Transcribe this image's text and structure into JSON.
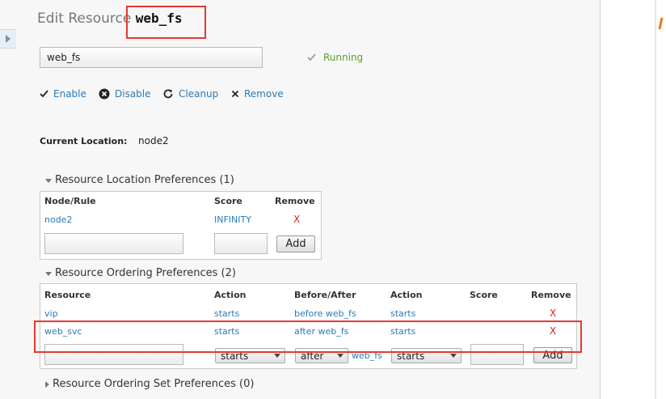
{
  "page": {
    "title_prefix": "Edit Resource",
    "resource_name": "web_fs"
  },
  "name_field": {
    "value": "web_fs"
  },
  "status": {
    "text": "Running",
    "color": "#5aa02c"
  },
  "actions": [
    {
      "label": "Enable",
      "icon": "check-icon"
    },
    {
      "label": "Disable",
      "icon": "disable-icon"
    },
    {
      "label": "Cleanup",
      "icon": "refresh-icon"
    },
    {
      "label": "Remove",
      "icon": "close-icon"
    }
  ],
  "current_location": {
    "label": "Current Location:",
    "value": "node2"
  },
  "location_prefs": {
    "title": "Resource Location Preferences (1)",
    "headers": {
      "node": "Node/Rule",
      "score": "Score",
      "remove": "Remove"
    },
    "rows": [
      {
        "node": "node2",
        "score": "INFINITY",
        "remove": "X"
      }
    ],
    "add_label": "Add"
  },
  "ordering_prefs": {
    "title": "Resource Ordering Preferences (2)",
    "headers": {
      "resource": "Resource",
      "action": "Action",
      "before_after": "Before/After",
      "action2": "Action",
      "score": "Score",
      "remove": "Remove"
    },
    "rows": [
      {
        "resource": "vip",
        "action": "starts",
        "before_after": "before web_fs",
        "action2": "starts",
        "score": "",
        "remove": "X"
      },
      {
        "resource": "web_svc",
        "action": "starts",
        "before_after": "after web_fs",
        "action2": "starts",
        "score": "",
        "remove": "X"
      }
    ],
    "new_row": {
      "action": "starts",
      "before_after": "after",
      "target": "web_fs",
      "action2": "starts"
    },
    "add_label": "Add"
  },
  "ordering_set_prefs": {
    "title": "Resource Ordering Set Preferences (0)"
  },
  "colors": {
    "link": "#2a7ab8",
    "remove": "#e0201a",
    "highlight": "#e53935"
  }
}
